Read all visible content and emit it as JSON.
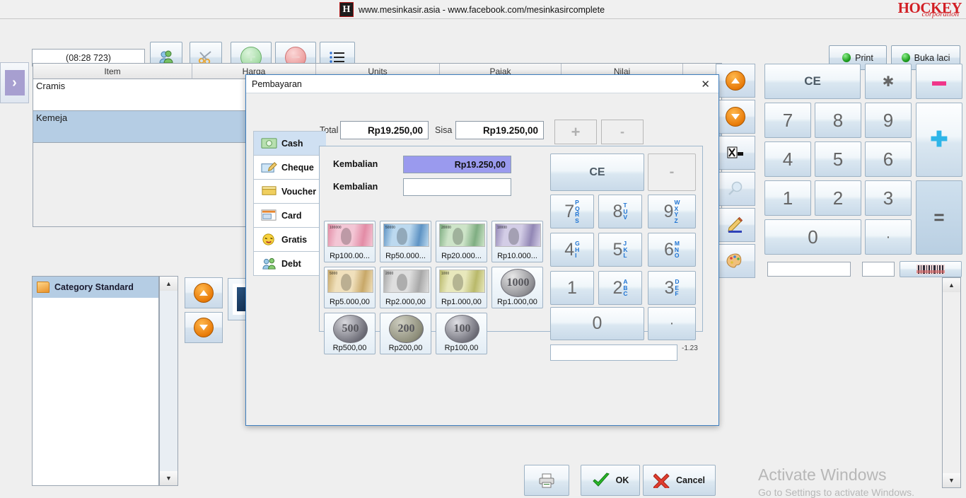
{
  "banner": {
    "logo_letter": "H",
    "text": "www.mesinkasir.asia - www.facebook.com/mesinkasircomplete",
    "brand": "HOCKEY",
    "brand_sub": "corporation"
  },
  "toolbar": {
    "time_value": "(08:28 723)",
    "buttons": [
      {
        "name": "customers-icon",
        "glyph": ""
      },
      {
        "name": "scissors-icon",
        "glyph": "✂"
      },
      {
        "name": "add-icon",
        "glyph": "+"
      },
      {
        "name": "remove-icon",
        "glyph": "−"
      },
      {
        "name": "list-icon",
        "glyph": ""
      }
    ],
    "print_label": "Print",
    "buka_laci_label": "Buka laci"
  },
  "slide_arrow": {
    "glyph": "›"
  },
  "items_table": {
    "columns": [
      "Item",
      "Harga",
      "Units",
      "Pajak",
      "Nilai",
      ""
    ],
    "rows": [
      {
        "item": "Cramis",
        "harga": "",
        "units": "",
        "pajak": "",
        "nilai": "",
        "selected": false
      },
      {
        "item": "Kemeja",
        "harga": "",
        "units": "",
        "pajak": "",
        "nilai": "",
        "selected": true
      }
    ]
  },
  "icon_rail": [
    {
      "name": "scroll-up-icon",
      "glyph": "▲"
    },
    {
      "name": "scroll-down-icon",
      "glyph": "▼"
    },
    {
      "name": "export-icon",
      "glyph": "⮞"
    },
    {
      "name": "search-icon",
      "glyph": "⌕"
    },
    {
      "name": "edit-pencil-icon",
      "glyph": "✎"
    },
    {
      "name": "palette-icon",
      "glyph": "◕"
    }
  ],
  "main_keypad": {
    "ce_label": "CE",
    "star_label": "✱",
    "minus_label": "▬",
    "plus_label": "✚",
    "equals_label": "=",
    "keys": [
      "7",
      "8",
      "9",
      "4",
      "5",
      "6",
      "1",
      "2",
      "3",
      "0",
      "·"
    ],
    "field1_value": "",
    "field2_value": "",
    "barcode_label": "barcode"
  },
  "category_panel": {
    "selected_label": "Category Standard"
  },
  "watermark": {
    "line1": "Activate Windows",
    "line2": "Go to Settings to activate Windows."
  },
  "dialog": {
    "title": "Pembayaran",
    "close_glyph": "✕",
    "total_label": "Total",
    "total_value": "Rp19.250,00",
    "sisa_label": "Sisa",
    "sisa_value": "Rp19.250,00",
    "plus_label": "+",
    "minus_label": "-",
    "tabs": [
      {
        "label": "Cash",
        "icon": "cash-icon",
        "active": true
      },
      {
        "label": "Cheque",
        "icon": "cheque-icon",
        "active": false
      },
      {
        "label": "Voucher",
        "icon": "voucher-icon",
        "active": false
      },
      {
        "label": "Card",
        "icon": "card-icon",
        "active": false
      },
      {
        "label": "Gratis",
        "icon": "gratis-icon",
        "active": false
      },
      {
        "label": "Debt",
        "icon": "debt-icon",
        "active": false
      }
    ],
    "kembalian1_label": "Kembalian",
    "kembalian1_value": "Rp19.250,00",
    "kembalian2_label": "Kembalian",
    "kembalian2_value": "",
    "denominations": [
      {
        "label": "Rp100.00...",
        "kind": "note",
        "note_value": "100000",
        "color1": "#f3c6d5",
        "color2": "#e38ca6"
      },
      {
        "label": "Rp50.000...",
        "kind": "note",
        "note_value": "50000",
        "color1": "#bcd9ef",
        "color2": "#5e93c4"
      },
      {
        "label": "Rp20.000...",
        "kind": "note",
        "note_value": "20000",
        "color1": "#cde4c8",
        "color2": "#7fae82"
      },
      {
        "label": "Rp10.000...",
        "kind": "note",
        "note_value": "10000",
        "color1": "#d3cde6",
        "color2": "#9287b5"
      },
      {
        "label": "Rp5.000,00",
        "kind": "note",
        "note_value": "5000",
        "color1": "#f0e0bc",
        "color2": "#c8a868"
      },
      {
        "label": "Rp2.000,00",
        "kind": "note",
        "note_value": "2000",
        "color1": "#dedede",
        "color2": "#a8a8a8"
      },
      {
        "label": "Rp1.000,00",
        "kind": "note",
        "note_value": "1000",
        "color1": "#e8e8bc",
        "color2": "#b9b96a"
      },
      {
        "label": "Rp1.000,00",
        "kind": "coin",
        "coin_value": "1000",
        "color1": "#e8e8e8",
        "color2": "#8d8d92"
      },
      {
        "label": "Rp500,00",
        "kind": "coin",
        "coin_value": "500",
        "color1": "#d8d8dd",
        "color2": "#6e6e78"
      },
      {
        "label": "Rp200,00",
        "kind": "coin",
        "coin_value": "200",
        "color1": "#cfcfc2",
        "color2": "#8c8c78"
      },
      {
        "label": "Rp100,00",
        "kind": "coin",
        "coin_value": "100",
        "color1": "#e0e0e5",
        "color2": "#70707a"
      }
    ],
    "keypad": {
      "ce_label": "CE",
      "dash_label": "-",
      "keys": [
        {
          "d": "7",
          "letters": [
            "P",
            "Q",
            "R",
            "S"
          ]
        },
        {
          "d": "8",
          "letters": [
            "T",
            "U",
            "V"
          ]
        },
        {
          "d": "9",
          "letters": [
            "W",
            "X",
            "Y",
            "Z"
          ]
        },
        {
          "d": "4",
          "letters": [
            "G",
            "H",
            "I"
          ]
        },
        {
          "d": "5",
          "letters": [
            "J",
            "K",
            "L"
          ]
        },
        {
          "d": "6",
          "letters": [
            "M",
            "N",
            "O"
          ]
        },
        {
          "d": "1",
          "letters": []
        },
        {
          "d": "2",
          "letters": [
            "A",
            "B",
            "C"
          ]
        },
        {
          "d": "3",
          "letters": [
            "D",
            "E",
            "F"
          ]
        }
      ],
      "zero_label": "0",
      "dot_label": "·",
      "input_value": "",
      "hint_label": "-1.23"
    },
    "footer": {
      "print_icon": "printer-icon",
      "ok_label": "OK",
      "cancel_label": "Cancel"
    }
  },
  "colors": {
    "selection_blue": "#b5cde4",
    "kembalian_purple": "#9a9aee",
    "accent_orange": "#e87b09",
    "brand_red": "#d21f25"
  }
}
